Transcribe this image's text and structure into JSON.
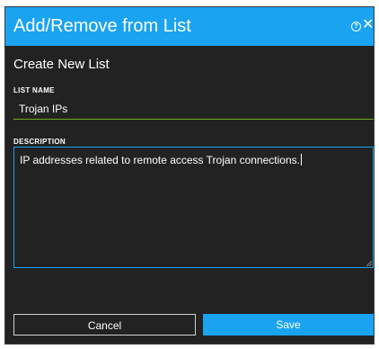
{
  "dialog": {
    "title": "Add/Remove from List",
    "help_symbol": "?",
    "close_symbol": "✕",
    "section_title": "Create New List",
    "list_name": {
      "label": "LIST NAME",
      "value": "Trojan IPs"
    },
    "description": {
      "label": "DESCRIPTION",
      "value": "IP addresses related to remote access Trojan connections."
    },
    "buttons": {
      "cancel": "Cancel",
      "save": "Save"
    }
  },
  "colors": {
    "accent": "#1aa3f0",
    "background": "#222222",
    "valid_underline": "#6fae1e"
  }
}
